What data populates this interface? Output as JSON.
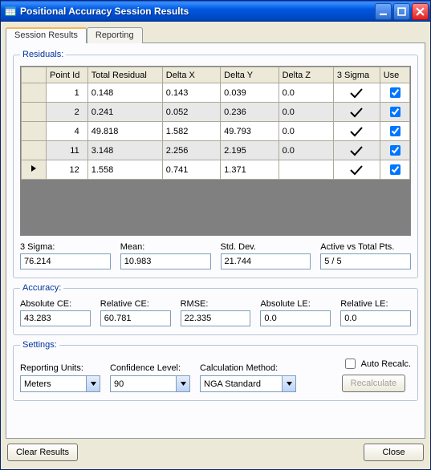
{
  "window": {
    "title": "Positional Accuracy Session Results"
  },
  "tabs": {
    "session_results": "Session Results",
    "reporting": "Reporting"
  },
  "residuals": {
    "legend": "Residuals:",
    "columns": {
      "point_id": "Point Id",
      "total_residual": "Total Residual",
      "delta_x": "Delta X",
      "delta_y": "Delta Y",
      "delta_z": "Delta Z",
      "three_sigma": "3 Sigma",
      "use": "Use"
    },
    "rows": [
      {
        "point_id": "1",
        "total_residual": "0.148",
        "delta_x": "0.143",
        "delta_y": "0.039",
        "delta_z": "0.0",
        "three_sigma": true,
        "use": true,
        "current": false
      },
      {
        "point_id": "2",
        "total_residual": "0.241",
        "delta_x": "0.052",
        "delta_y": "0.236",
        "delta_z": "0.0",
        "three_sigma": true,
        "use": true,
        "current": false
      },
      {
        "point_id": "4",
        "total_residual": "49.818",
        "delta_x": "1.582",
        "delta_y": "49.793",
        "delta_z": "0.0",
        "three_sigma": true,
        "use": true,
        "current": false
      },
      {
        "point_id": "11",
        "total_residual": "3.148",
        "delta_x": "2.256",
        "delta_y": "2.195",
        "delta_z": "0.0",
        "three_sigma": true,
        "use": true,
        "current": false
      },
      {
        "point_id": "12",
        "total_residual": "1.558",
        "delta_x": "0.741",
        "delta_y": "1.371",
        "delta_z": "",
        "three_sigma": true,
        "use": true,
        "current": true
      }
    ],
    "stats": {
      "three_sigma_label": "3 Sigma:",
      "three_sigma": "76.214",
      "mean_label": "Mean:",
      "mean": "10.983",
      "stddev_label": "Std. Dev.",
      "stddev": "21.744",
      "active_label": "Active vs Total Pts.",
      "active": "5 / 5"
    }
  },
  "accuracy": {
    "legend": "Accuracy:",
    "absolute_ce_label": "Absolute CE:",
    "absolute_ce": "43.283",
    "relative_ce_label": "Relative CE:",
    "relative_ce": "60.781",
    "rmse_label": "RMSE:",
    "rmse": "22.335",
    "absolute_le_label": "Absolute LE:",
    "absolute_le": "0.0",
    "relative_le_label": "Relative LE:",
    "relative_le": "0.0"
  },
  "settings": {
    "legend": "Settings:",
    "reporting_units_label": "Reporting Units:",
    "reporting_units": "Meters",
    "confidence_label": "Confidence Level:",
    "confidence": "90",
    "calc_method_label": "Calculation Method:",
    "calc_method": "NGA Standard",
    "auto_recalc_label": "Auto Recalc.",
    "recalculate_label": "Recalculate"
  },
  "footer": {
    "clear_results": "Clear Results",
    "close": "Close"
  }
}
